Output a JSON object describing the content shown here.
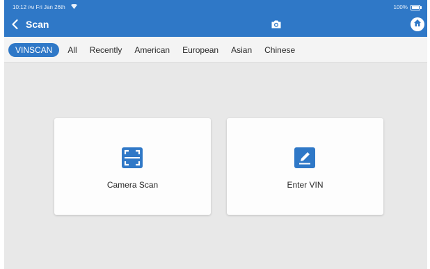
{
  "status": {
    "time": "10:12",
    "ampm": "PM",
    "date": "Fri Jan 26th",
    "battery": "100%"
  },
  "header": {
    "title": "Scan",
    "back_icon": "back-arrow-icon",
    "camera_icon": "camera-icon",
    "home_icon": "home-icon",
    "color": "#2f78c7"
  },
  "tabs": [
    {
      "label": "VINSCAN",
      "active": true
    },
    {
      "label": "All"
    },
    {
      "label": "Recently"
    },
    {
      "label": "American"
    },
    {
      "label": "European"
    },
    {
      "label": "Asian"
    },
    {
      "label": "Chinese"
    }
  ],
  "cards": [
    {
      "label": "Camera Scan",
      "icon": "scan-frame-icon"
    },
    {
      "label": "Enter VIN",
      "icon": "edit-pencil-icon"
    }
  ]
}
